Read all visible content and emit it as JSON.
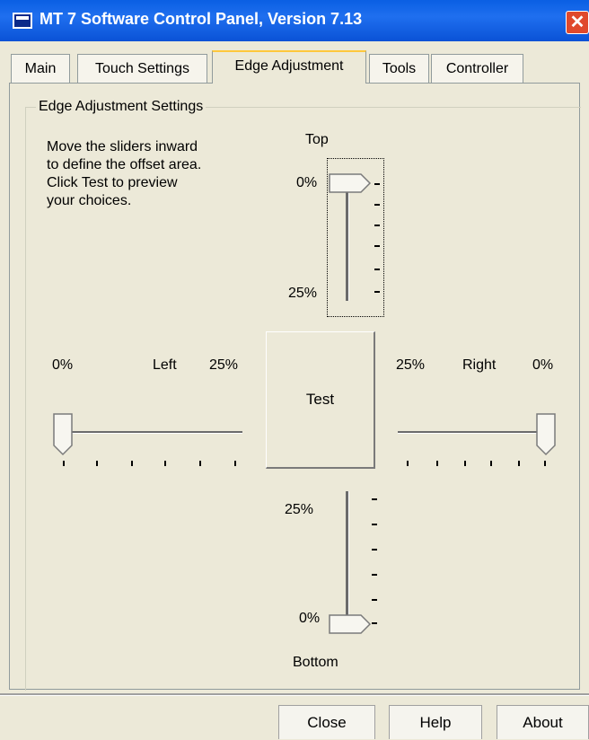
{
  "window": {
    "title": "MT 7 Software Control Panel, Version 7.13",
    "close_glyph": "✕"
  },
  "tabs": [
    {
      "label": "Main",
      "active": false
    },
    {
      "label": "Touch Settings",
      "active": false
    },
    {
      "label": "Edge Adjustment",
      "active": true
    },
    {
      "label": "Tools",
      "active": false
    },
    {
      "label": "Controller",
      "active": false
    }
  ],
  "group": {
    "label": "Edge Adjustment Settings",
    "instructions": "Move the sliders inward\nto define the offset area.\nClick Test to preview\nyour choices."
  },
  "sliders": {
    "top": {
      "label": "Top",
      "min_label": "0%",
      "max_label": "25%",
      "value_percent": 0
    },
    "left": {
      "label": "Left",
      "min_label": "0%",
      "max_label": "25%",
      "value_percent": 0
    },
    "right": {
      "label": "Right",
      "min_label": "0%",
      "max_label": "25%",
      "value_percent": 0
    },
    "bottom": {
      "label": "Bottom",
      "min_label": "0%",
      "max_label": "25%",
      "value_percent": 0
    }
  },
  "test_button": "Test",
  "footer": {
    "close": "Close",
    "help": "Help",
    "about": "About"
  },
  "colors": {
    "titlebar": "#0A5FE3",
    "face": "#ECE9D8",
    "close": "#E0492C",
    "tab_highlight": "#FFC83C"
  }
}
